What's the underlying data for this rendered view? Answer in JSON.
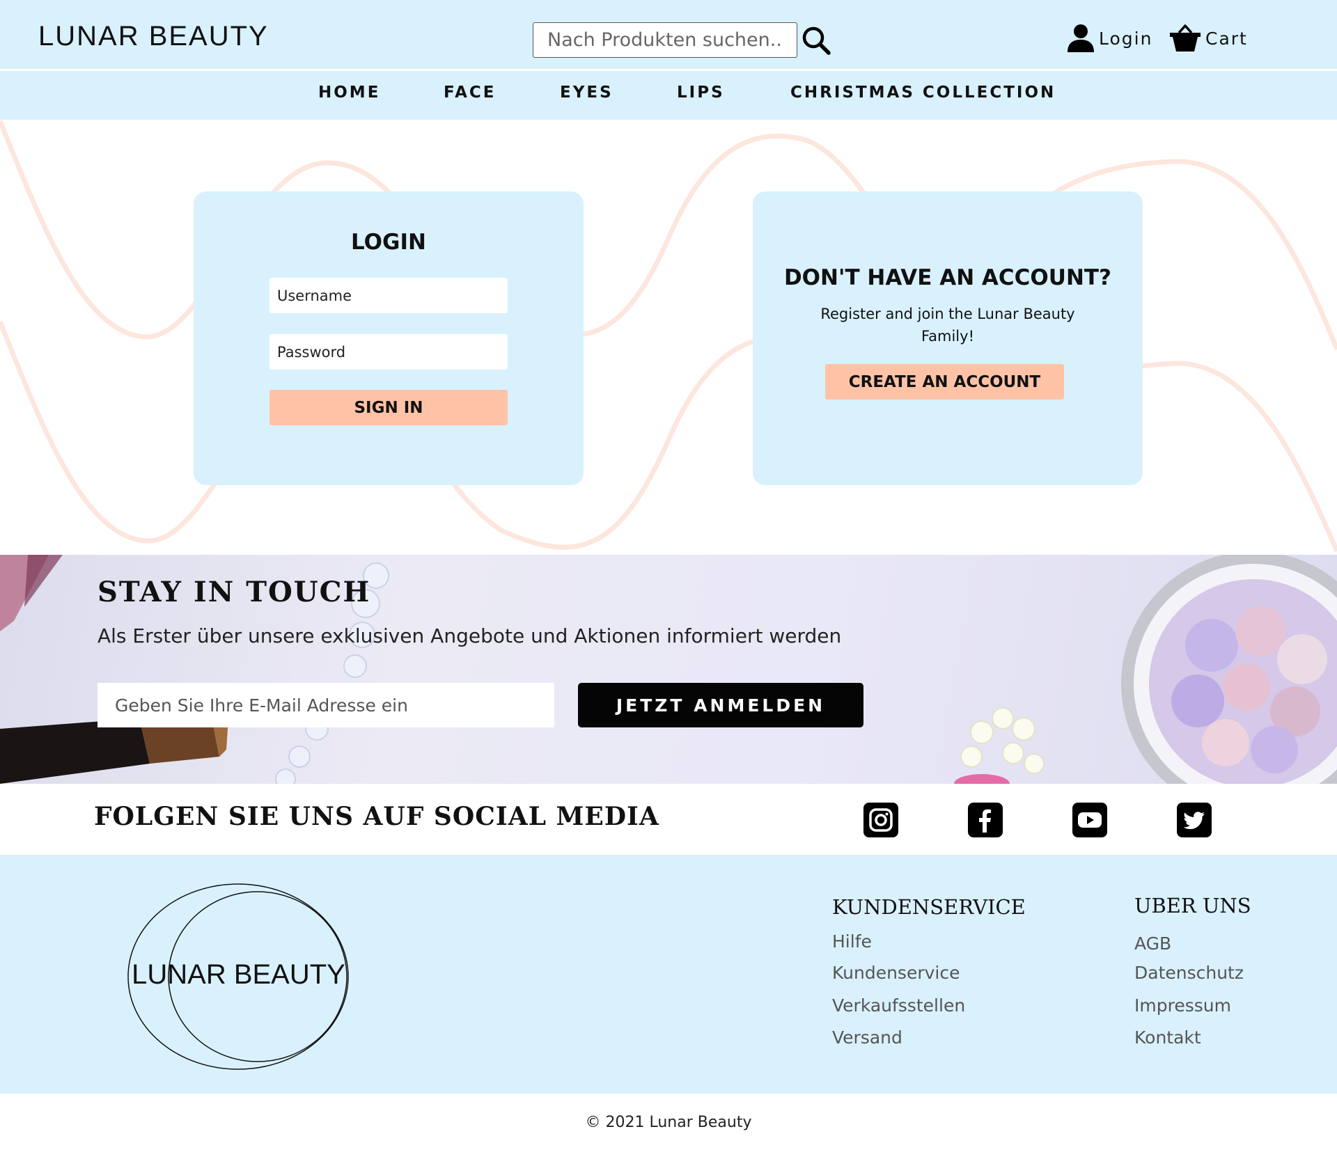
{
  "header": {
    "brand": "LUNAR BEAUTY",
    "search_placeholder": "Nach Produkten suchen...",
    "login_label": "Login",
    "cart_label": "Cart"
  },
  "nav": {
    "items": [
      {
        "label": "HOME"
      },
      {
        "label": "FACE"
      },
      {
        "label": "EYES"
      },
      {
        "label": "LIPS"
      },
      {
        "label": "CHRISTMAS COLLECTION"
      }
    ]
  },
  "login": {
    "title": "LOGIN",
    "username_placeholder": "Username",
    "password_placeholder": "Password",
    "sign_in_label": "SIGN IN"
  },
  "register": {
    "title": "DON'T HAVE AN ACCOUNT?",
    "text": "Register and join the Lunar Beauty Family!",
    "button_label": "CREATE AN ACCOUNT"
  },
  "newsletter": {
    "title": "STAY IN TOUCH",
    "subtitle": "Als Erster über unsere exklusiven Angebote und Aktionen informiert werden",
    "email_placeholder": "Geben Sie Ihre E-Mail Adresse ein",
    "button_label": "JETZT ANMELDEN"
  },
  "social": {
    "title": "FOLGEN SIE UNS AUF SOCIAL MEDIA",
    "icons": [
      "instagram-icon",
      "facebook-icon",
      "youtube-icon",
      "twitter-icon"
    ]
  },
  "footer": {
    "logo_text": "LUNAR BEAUTY",
    "kundenservice": {
      "title": "KUNDENSERVICE",
      "links": [
        "Hilfe",
        "Kundenservice",
        "Verkaufsstellen",
        "Versand"
      ]
    },
    "ueber_uns": {
      "title": "UBER UNS",
      "links": [
        "AGB",
        "Datenschutz",
        "Impressum",
        "Kontakt"
      ]
    }
  },
  "copyright": "© 2021 Lunar Beauty",
  "colors": {
    "light_blue": "#d9f1fd",
    "peach": "#fec3a6",
    "wave": "#fde6dd",
    "black": "#050505"
  }
}
